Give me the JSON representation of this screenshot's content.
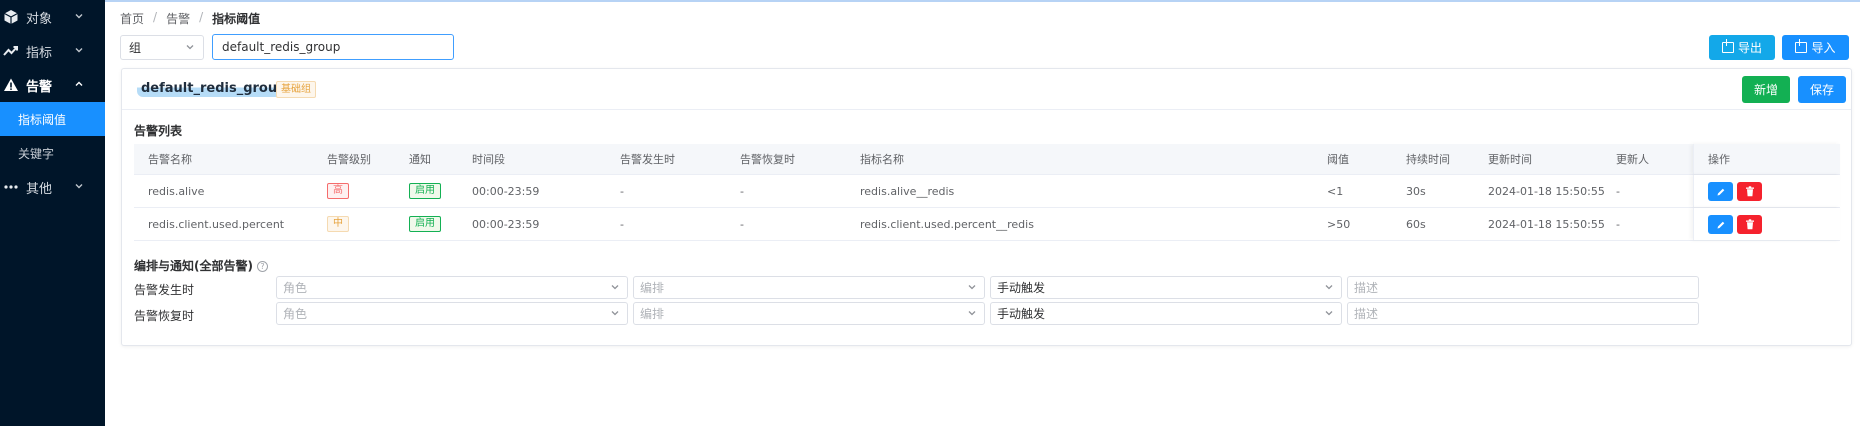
{
  "sidebar": {
    "items": [
      {
        "label": "对象",
        "icon": "cube-icon",
        "expanded": false
      },
      {
        "label": "指标",
        "icon": "trend-icon",
        "expanded": false
      },
      {
        "label": "告警",
        "icon": "warning-icon",
        "expanded": true
      },
      {
        "label": "其他",
        "icon": "ellipsis-icon",
        "expanded": false
      }
    ],
    "sub_items": [
      {
        "label": "指标阈值",
        "active": true
      },
      {
        "label": "关键字",
        "active": false
      }
    ]
  },
  "breadcrumb": [
    "首页",
    "告警",
    "指标阈值"
  ],
  "filter": {
    "group_select": "组",
    "group_input": "default_redis_group"
  },
  "toolbar": {
    "export_label": "导出",
    "import_label": "导入"
  },
  "card": {
    "group_name": "default_redis_group",
    "group_tag": "基础组",
    "add_label": "新增",
    "save_label": "保存"
  },
  "alarm_list": {
    "title": "告警列表",
    "columns": [
      "告警名称",
      "告警级别",
      "通知",
      "时间段",
      "告警发生时",
      "告警恢复时",
      "指标名称",
      "阈值",
      "持续时间",
      "更新时间",
      "更新人",
      "操作"
    ],
    "rows": [
      {
        "name": "redis.alive",
        "level": "高",
        "level_type": "high",
        "notify": "启用",
        "period": "00:00-23:59",
        "on_alarm": "-",
        "on_recover": "-",
        "metric": "redis.alive__redis",
        "threshold": "<1",
        "duration": "30s",
        "updated": "2024-01-18 15:50:55",
        "updater": "-"
      },
      {
        "name": "redis.client.used.percent",
        "level": "中",
        "level_type": "mid",
        "notify": "启用",
        "period": "00:00-23:59",
        "on_alarm": "-",
        "on_recover": "-",
        "metric": "redis.client.used.percent__redis",
        "threshold": ">50",
        "duration": "60s",
        "updated": "2024-01-18 15:50:55",
        "updater": "-"
      }
    ]
  },
  "schedule": {
    "title": "编排与通知(全部告警)",
    "help": "?",
    "rows": [
      {
        "label": "告警发生时",
        "role_placeholder": "角色",
        "schedule_placeholder": "编排",
        "trigger": "手动触发",
        "desc_placeholder": "描述"
      },
      {
        "label": "告警恢复时",
        "role_placeholder": "角色",
        "schedule_placeholder": "编排",
        "trigger": "手动触发",
        "desc_placeholder": "描述"
      }
    ]
  },
  "colors": {
    "sidebar_bg": "#001529",
    "active": "#1890ff",
    "add": "#13b053",
    "export": "#13a8e9",
    "danger": "#f5222d"
  }
}
